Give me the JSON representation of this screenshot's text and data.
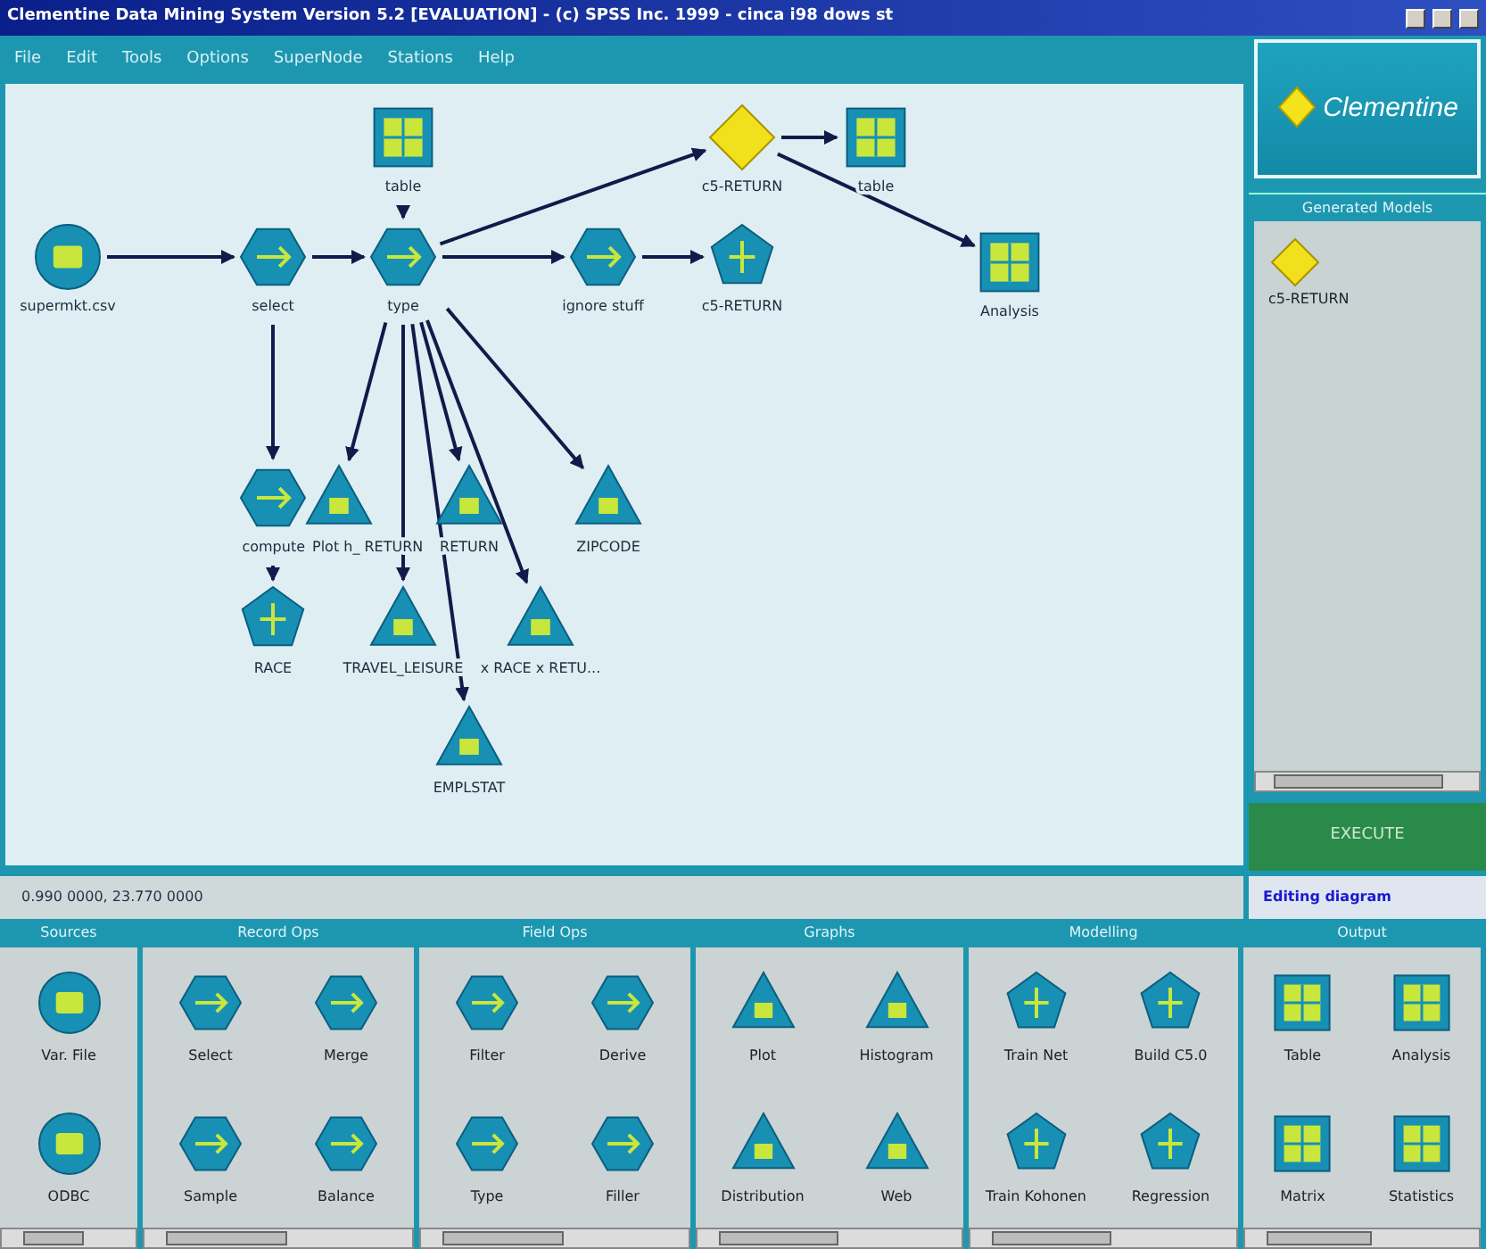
{
  "window": {
    "title": "Clementine Data Mining System Version 5.2 [EVALUATION] - (c) SPSS Inc. 1999 - cinca i98 dows st"
  },
  "menu": [
    "File",
    "Edit",
    "Tools",
    "Options",
    "SuperNode",
    "Stations",
    "Help"
  ],
  "logo": {
    "text": "Clementine"
  },
  "canvas": {
    "nodes": [
      {
        "label": "table",
        "kind": "output"
      },
      {
        "label": "c5-RETURN",
        "kind": "generated"
      },
      {
        "label": "table",
        "kind": "output"
      },
      {
        "label": "supermkt.csv",
        "kind": "source"
      },
      {
        "label": "select",
        "kind": "process"
      },
      {
        "label": "type",
        "kind": "process"
      },
      {
        "label": "ignore stuff",
        "kind": "process"
      },
      {
        "label": "c5-RETURN",
        "kind": "model"
      },
      {
        "label": "Analysis",
        "kind": "output"
      },
      {
        "label": "compute",
        "kind": "process"
      },
      {
        "label": "Plot h_ RETURN",
        "kind": "graph"
      },
      {
        "label": "RETURN",
        "kind": "graph"
      },
      {
        "label": "ZIPCODE",
        "kind": "graph"
      },
      {
        "label": "RACE",
        "kind": "model"
      },
      {
        "label": "TRAVEL_LEISURE",
        "kind": "graph"
      },
      {
        "label": "x RACE x RETU...",
        "kind": "graph"
      },
      {
        "label": "EMPLSTAT",
        "kind": "graph"
      }
    ]
  },
  "generated_models": {
    "title": "Generated Models",
    "items": [
      {
        "label": "c5-RETURN",
        "kind": "generated"
      }
    ]
  },
  "execute_button": "EXECUTE",
  "status_bar": {
    "coordinates": "0.990 0000, 23.770 0000",
    "mode": "Editing diagram"
  },
  "palettes": [
    {
      "title": "Sources",
      "items": [
        {
          "label": "Var. File",
          "kind": "source"
        },
        {
          "label": "ODBC",
          "kind": "source"
        }
      ]
    },
    {
      "title": "Record Ops",
      "items": [
        {
          "label": "Select",
          "kind": "process"
        },
        {
          "label": "Merge",
          "kind": "process"
        },
        {
          "label": "Sample",
          "kind": "process"
        },
        {
          "label": "Balance",
          "kind": "process"
        }
      ]
    },
    {
      "title": "Field Ops",
      "items": [
        {
          "label": "Filter",
          "kind": "process"
        },
        {
          "label": "Derive",
          "kind": "process"
        },
        {
          "label": "Type",
          "kind": "process"
        },
        {
          "label": "Filler",
          "kind": "process"
        }
      ]
    },
    {
      "title": "Graphs",
      "items": [
        {
          "label": "Plot",
          "kind": "graph"
        },
        {
          "label": "Histogram",
          "kind": "graph"
        },
        {
          "label": "Distribution",
          "kind": "graph"
        },
        {
          "label": "Web",
          "kind": "graph"
        }
      ]
    },
    {
      "title": "Modelling",
      "items": [
        {
          "label": "Train Net",
          "kind": "model"
        },
        {
          "label": "Build C5.0",
          "kind": "model"
        },
        {
          "label": "Train Kohonen",
          "kind": "model"
        },
        {
          "label": "Regression",
          "kind": "model"
        }
      ]
    },
    {
      "title": "Output",
      "items": [
        {
          "label": "Table",
          "kind": "output"
        },
        {
          "label": "Analysis",
          "kind": "output"
        },
        {
          "label": "Matrix",
          "kind": "output"
        },
        {
          "label": "Statistics",
          "kind": "output"
        }
      ]
    }
  ]
}
